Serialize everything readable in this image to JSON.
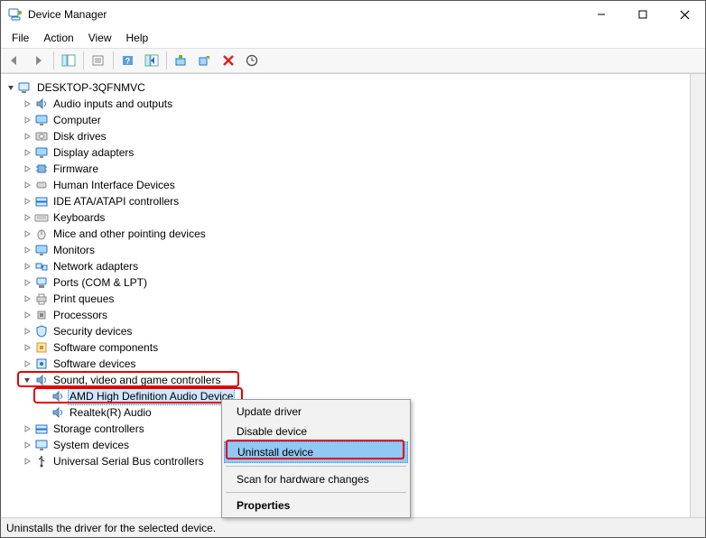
{
  "window": {
    "title": "Device Manager"
  },
  "menubar": {
    "file": "File",
    "action": "Action",
    "view": "View",
    "help": "Help"
  },
  "toolbar_icons": {
    "back": "back-icon",
    "forward": "forward-icon",
    "show_hide": "show-hide-tree-icon",
    "properties": "properties-icon",
    "help": "help-icon",
    "refresh": "refresh-icon",
    "update_driver": "update-driver-icon",
    "uninstall": "uninstall-icon",
    "delete": "delete-icon",
    "scan": "scan-hardware-icon"
  },
  "root": "DESKTOP-3QFNMVC",
  "categories": [
    {
      "label": "Audio inputs and outputs",
      "icon": "speaker-icon"
    },
    {
      "label": "Computer",
      "icon": "monitor-icon"
    },
    {
      "label": "Disk drives",
      "icon": "disk-icon"
    },
    {
      "label": "Display adapters",
      "icon": "monitor-icon"
    },
    {
      "label": "Firmware",
      "icon": "chip-icon"
    },
    {
      "label": "Human Interface Devices",
      "icon": "hid-icon"
    },
    {
      "label": "IDE ATA/ATAPI controllers",
      "icon": "storage-controller-icon"
    },
    {
      "label": "Keyboards",
      "icon": "keyboard-icon"
    },
    {
      "label": "Mice and other pointing devices",
      "icon": "mouse-icon"
    },
    {
      "label": "Monitors",
      "icon": "monitor-icon"
    },
    {
      "label": "Network adapters",
      "icon": "network-icon"
    },
    {
      "label": "Ports (COM & LPT)",
      "icon": "port-icon"
    },
    {
      "label": "Print queues",
      "icon": "printer-icon"
    },
    {
      "label": "Processors",
      "icon": "cpu-icon"
    },
    {
      "label": "Security devices",
      "icon": "security-icon"
    },
    {
      "label": "Software components",
      "icon": "software-component-icon"
    },
    {
      "label": "Software devices",
      "icon": "software-device-icon"
    },
    {
      "label": "Sound, video and game controllers",
      "icon": "speaker-icon",
      "expanded": true,
      "highlighted": true,
      "children": [
        {
          "label": "AMD High Definition Audio Device",
          "icon": "speaker-icon",
          "selected": true,
          "highlighted": true
        },
        {
          "label": "Realtek(R) Audio",
          "icon": "speaker-icon"
        }
      ]
    },
    {
      "label": "Storage controllers",
      "icon": "storage-controller-icon"
    },
    {
      "label": "System devices",
      "icon": "system-icon"
    },
    {
      "label": "Universal Serial Bus controllers",
      "icon": "usb-icon"
    }
  ],
  "context_menu": {
    "items": [
      {
        "label": "Update driver"
      },
      {
        "label": "Disable device"
      },
      {
        "label": "Uninstall device",
        "selected": true,
        "highlighted": true
      },
      {
        "sep": true
      },
      {
        "label": "Scan for hardware changes"
      },
      {
        "sep": true
      },
      {
        "label": "Properties",
        "bold": true
      }
    ]
  },
  "statusbar": "Uninstalls the driver for the selected device."
}
